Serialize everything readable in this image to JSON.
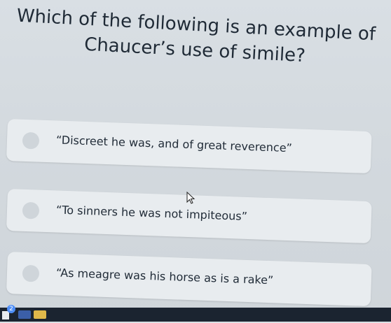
{
  "question": {
    "line1": "Which of the following is an example of",
    "line2": "Chaucer’s use of simile?"
  },
  "options": [
    {
      "label": "“Discreet he was, and of great reverence”"
    },
    {
      "label": "“To sinners he was not impiteous”"
    },
    {
      "label": "“As meagre was his horse as is a rake”"
    }
  ],
  "taskbar": {
    "badge_count": "2"
  },
  "colors": {
    "background": "#d3d9de",
    "option_bg": "#e8ecef",
    "text": "#1f2a36"
  }
}
